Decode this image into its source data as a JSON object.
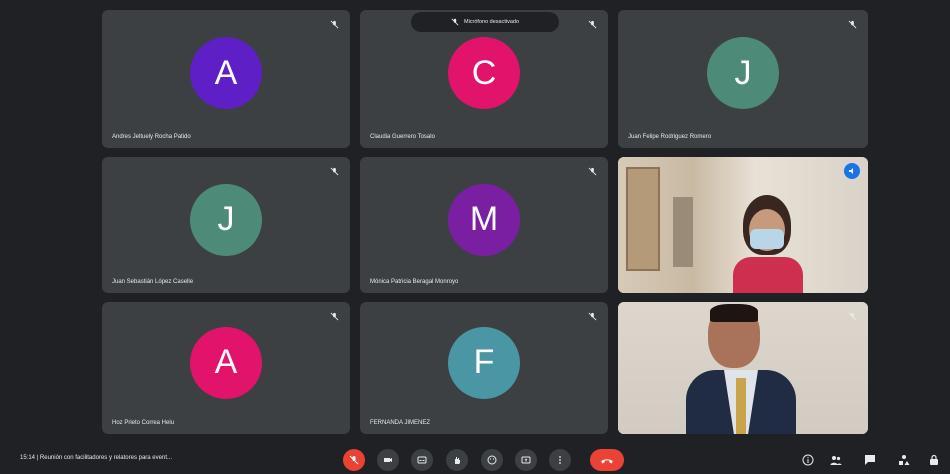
{
  "toast": {
    "text": "Micrófono desactivado"
  },
  "participants": [
    {
      "name": "Andres Jeltuely Rocha Patido",
      "initial": "A",
      "color": "#5f1fc7"
    },
    {
      "name": "Claudia Guerrero Tosalo",
      "initial": "C",
      "color": "#e2136b"
    },
    {
      "name": "Juan Felipe Rodriguez Romero",
      "initial": "J",
      "color": "#4d8b78"
    },
    {
      "name": "Juan Sebastián López Caselle",
      "initial": "J",
      "color": "#4d8b78"
    },
    {
      "name": "Mónica Patricia Beragal Monroyo",
      "initial": "M",
      "color": "#7b1fa2"
    },
    {
      "name": "Hoz Prieto Correa Helu",
      "initial": "A",
      "color": "#e2136b"
    },
    {
      "name": "FERNANDA JIMENEZ",
      "initial": "F",
      "color": "#4a96a5"
    }
  ],
  "bottom_bar": {
    "meeting_info": "15:14  |  Reunión con facilitadores y relatores para event..."
  },
  "colors": {
    "background": "#202124",
    "tile": "#3c4043",
    "end_call": "#ea4335",
    "accent": "#1a73e8"
  },
  "icons": [
    "mic-off-icon",
    "video-off-icon",
    "captions-icon",
    "hand-icon",
    "emoji-icon",
    "present-icon",
    "more-icon",
    "end-call-icon",
    "info-icon",
    "people-icon",
    "chat-icon",
    "activities-icon",
    "lock-icon",
    "pin-icon"
  ]
}
